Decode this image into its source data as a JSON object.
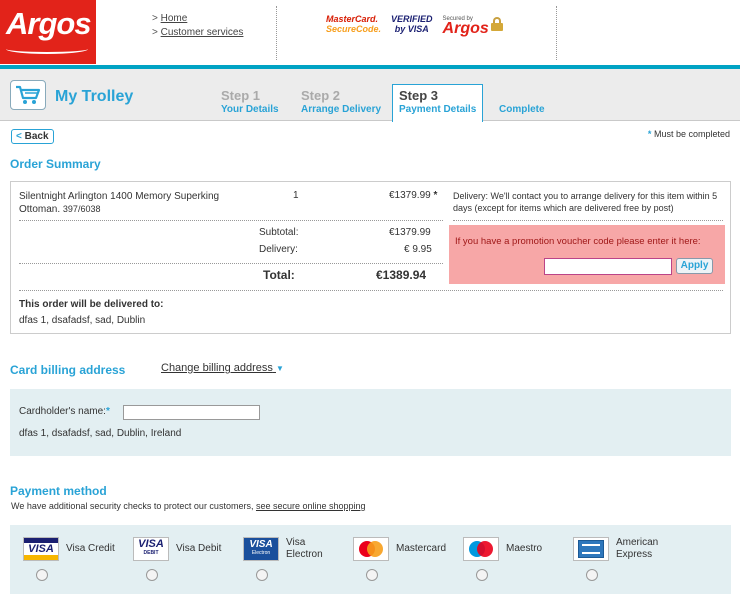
{
  "header": {
    "logo_text": "Argos",
    "links": [
      "Home",
      "Customer services"
    ],
    "secure_logos": {
      "mastercard_l1": "MasterCard.",
      "mastercard_l2": "SecureCode.",
      "verified_l1": "VERIFIED",
      "verified_l2": "by VISA",
      "secured_small": "Secured by",
      "secured_big": "Argos"
    }
  },
  "nav": {
    "title": "My Trolley",
    "steps": [
      {
        "number": "Step 1",
        "label": "Your Details"
      },
      {
        "number": "Step 2",
        "label": "Arrange Delivery"
      },
      {
        "number": "Step 3",
        "label": "Payment Details"
      }
    ],
    "complete": "Complete"
  },
  "back_label": "Back",
  "must_text": "Must be completed",
  "order_summary": {
    "heading": "Order Summary",
    "item_name": "Silentnight Arlington 1400 Memory Superking",
    "item_name_2": "Ottoman.",
    "item_code": "397/6038",
    "quantity": "1",
    "price": "€1379.99",
    "delivery_note": "Delivery: We'll contact you to arrange delivery for this item within 5 days (except for items which are delivered free by post)",
    "subtotal_label": "Subtotal:",
    "subtotal_value": "€1379.99",
    "delivery_label": "Delivery:",
    "delivery_value": "€ 9.95",
    "total_label": "Total:",
    "total_value": "€1389.94",
    "promo_text": "If you have a promotion voucher code please enter it here:",
    "apply_label": "Apply",
    "delivered_to_label": "This order will be delivered to:",
    "delivered_to_address": "dfas 1, dsafadsf, sad, Dublin"
  },
  "billing": {
    "heading": "Card billing address",
    "change_link": "Change billing address",
    "cardholder_label": "Cardholder's name:",
    "address": "dfas 1, dsafadsf, sad, Dublin, Ireland"
  },
  "payment": {
    "heading": "Payment method",
    "note": "We have additional security checks to protect our customers,",
    "note_link": "see secure online shopping",
    "cards": [
      {
        "label": "Visa Credit",
        "icon": "visa-icon"
      },
      {
        "label": "Visa Debit",
        "icon": "visa-debit-icon"
      },
      {
        "label": "Visa Electron",
        "icon": "visa-electron-icon"
      },
      {
        "label": "Mastercard",
        "icon": "mastercard-icon"
      },
      {
        "label": "Maestro",
        "icon": "maestro-icon"
      },
      {
        "label": "American Express",
        "icon": "amex-icon"
      }
    ]
  }
}
